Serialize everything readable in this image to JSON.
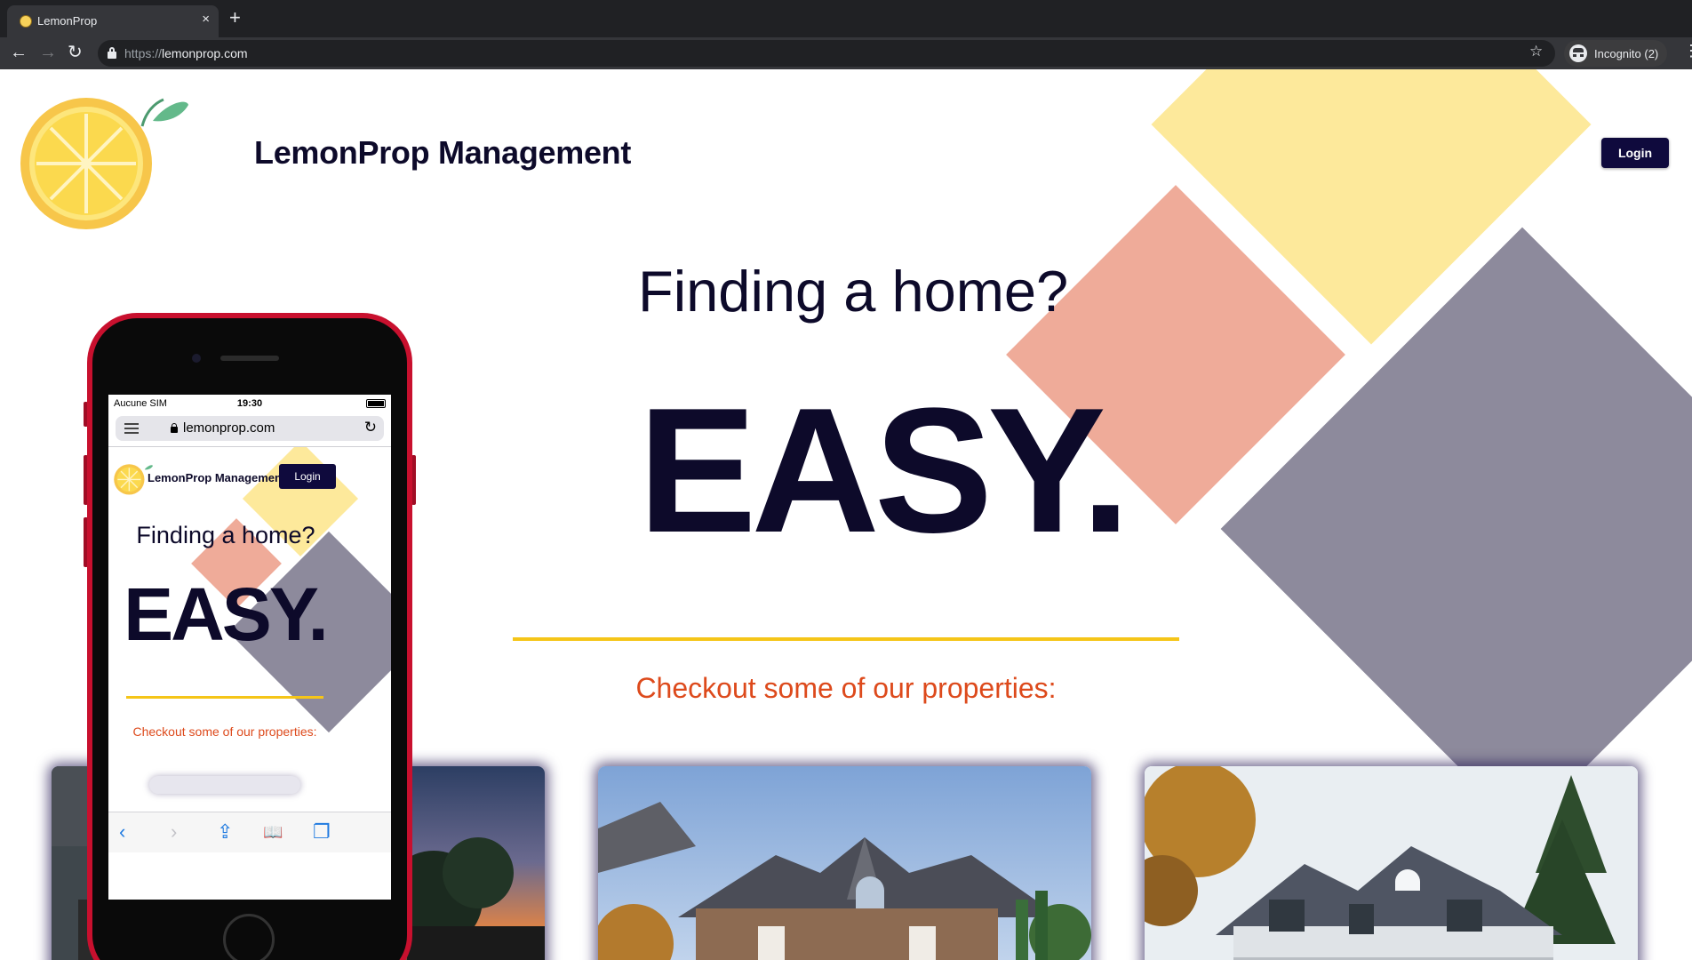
{
  "browser": {
    "tab": {
      "title": "LemonProp",
      "close_label": "×"
    },
    "new_tab_label": "+",
    "nav": {
      "back": "←",
      "forward": "→",
      "reload": "↻"
    },
    "url": {
      "scheme": "https://",
      "host": "lemonprop.com"
    },
    "bookmark_label": "☆",
    "profile_label": "Incognito (2)",
    "menu_label": "⋮"
  },
  "site": {
    "title": "LemonProp Management",
    "login_label": "Login",
    "hero": {
      "question": "Finding a home?",
      "headline": "EASY."
    },
    "properties_heading": "Checkout some of our properties:",
    "colors": {
      "navy": "#0d0a2a",
      "button": "#0f0a3d",
      "yellow": "#fde99b",
      "pink": "#efab99",
      "gray": "#8d8a9c",
      "rule": "#f5c518",
      "accent": "#dd4a1c"
    }
  },
  "phone": {
    "status": {
      "carrier": "Aucune SIM",
      "time": "19:30"
    },
    "url": "lemonprop.com",
    "reload_label": "↻",
    "site_title": "LemonProp Management",
    "login_label": "Login",
    "question": "Finding a home?",
    "headline": "EASY.",
    "properties_heading": "Checkout some of our properties:",
    "toolbar": {
      "back": "‹",
      "forward": "›",
      "share": "⇪",
      "bookmarks": "📖",
      "tabs": "❐"
    }
  }
}
